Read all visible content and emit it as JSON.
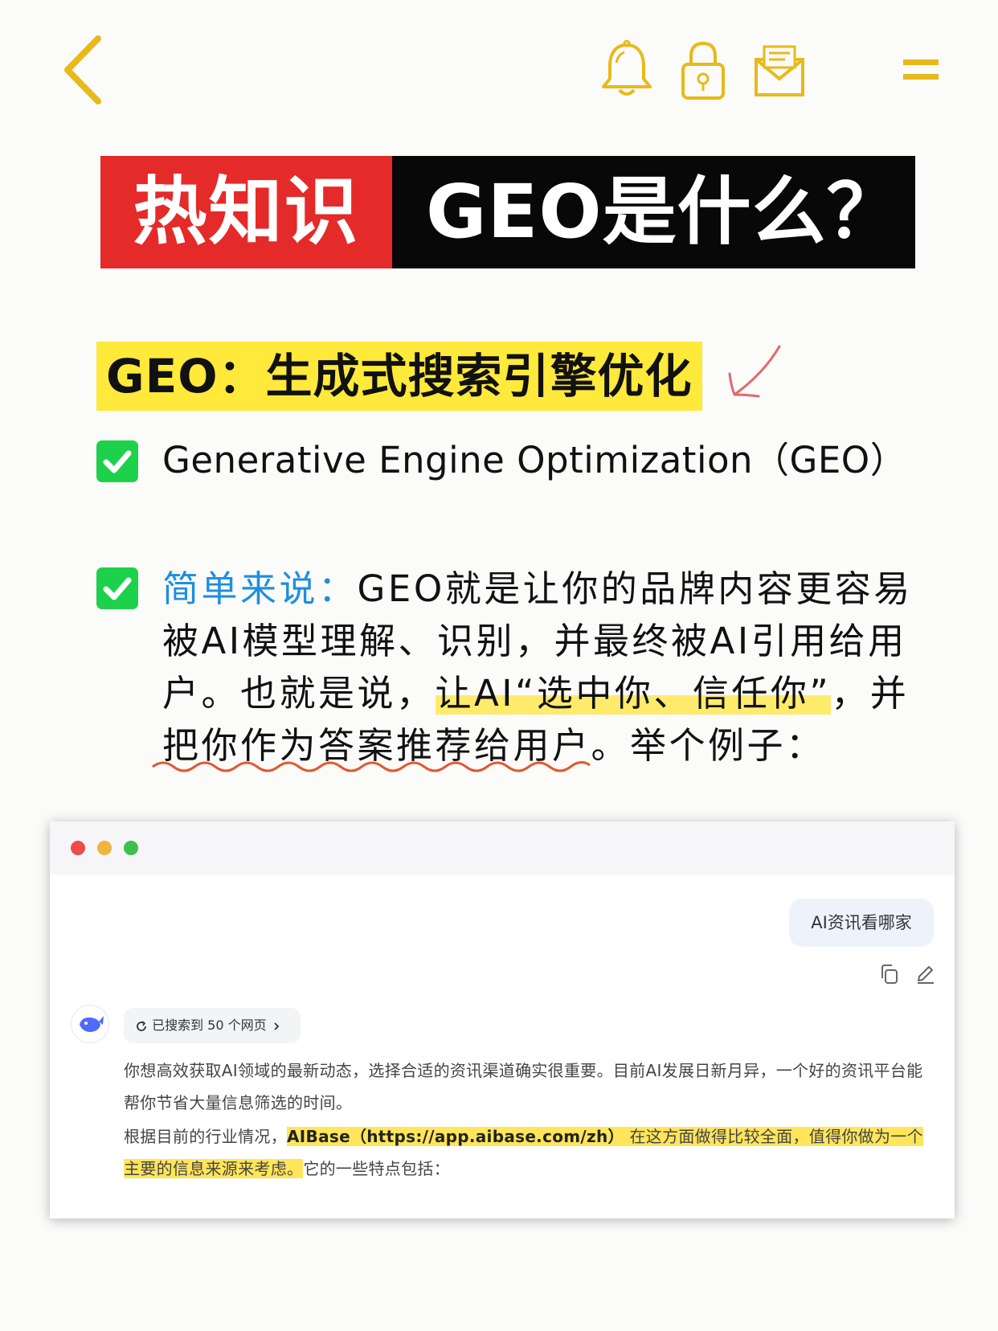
{
  "nav": {
    "icons": [
      "chevron-left-icon",
      "bell-icon",
      "lock-icon",
      "mail-icon",
      "menu-icon"
    ],
    "accent": "#e8b91a"
  },
  "banner": {
    "left": "热知识",
    "right": "GEO是什么？",
    "left_color": "#e52a2a",
    "right_color": "#080808"
  },
  "heading": {
    "text": "GEO：生成式搜索引擎优化",
    "highlight_color": "#ffe93a"
  },
  "definition": {
    "text": "Generative Engine Optimization（GEO）"
  },
  "explanation": {
    "lead": "简单来说：",
    "part1": "GEO就是让你的品牌内容更容易被AI模型理解、识别，并最终被AI引用给用户。也就是说，",
    "highlight": "让AI“选中你、信任你”",
    "part2": "，并",
    "wavy": "把你作为答案推荐给用户",
    "part3": "。举个例子："
  },
  "chat": {
    "user_message": "AI资讯看哪家",
    "search_status": "已搜索到 50 个网页",
    "reply_p1": "你想高效获取AI领域的最新动态，选择合适的资讯渠道确实很重要。目前AI发展日新月异，一个好的资讯平台能帮你节省大量信息筛选的时间。",
    "reply_p2_prefix": "根据目前的行业情况，",
    "reply_p2_brand": "AIBase",
    "reply_p2_link": "（https://app.aibase.com/zh）",
    "reply_p2_highlight": "在这方面做得比较全面，值得你做为一个主要的信息来源来考虑。",
    "reply_p2_suffix": "它的一些特点包括："
  }
}
